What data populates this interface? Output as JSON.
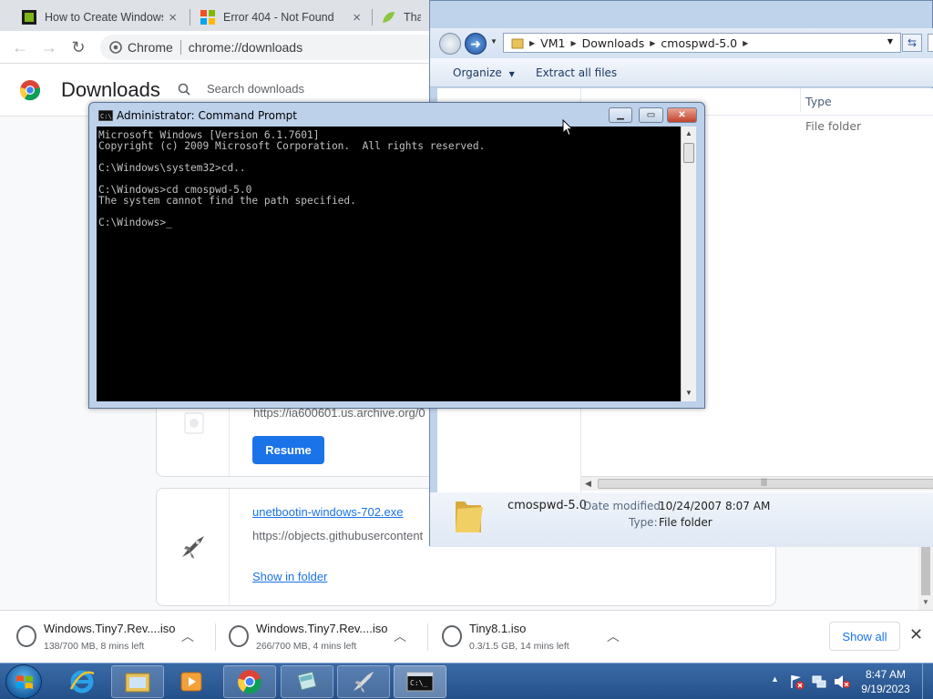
{
  "chrome": {
    "tabs": [
      {
        "title": "How to Create Windows",
        "close": "×"
      },
      {
        "title": "Error 404 - Not Found",
        "close": "×"
      },
      {
        "title": "Thank",
        "close": ""
      }
    ],
    "omnibox": {
      "chip": "Chrome",
      "url": "chrome://downloads"
    },
    "page_title": "Downloads",
    "search_placeholder": "Search downloads"
  },
  "downloads": {
    "items": [
      {
        "url": "https://ia600601.us.archive.org/0",
        "button": "Resume"
      },
      {
        "filename": "unetbootin-windows-702.exe",
        "url": "https://objects.githubusercontent",
        "action": "Show in folder"
      }
    ]
  },
  "shelf": {
    "items": [
      {
        "name": "Windows.Tiny7.Rev....iso",
        "status": "138/700 MB, 8 mins left"
      },
      {
        "name": "Windows.Tiny7.Rev....iso",
        "status": "266/700 MB, 4 mins left"
      },
      {
        "name": "Tiny8.1.iso",
        "status": "0.3/1.5 GB, 14 mins left"
      }
    ],
    "show_all": "Show all"
  },
  "explorer": {
    "breadcrumbs": [
      "VM1",
      "Downloads",
      "cmospwd-5.0"
    ],
    "commands": {
      "organize": "Organize",
      "extract": "Extract all files"
    },
    "column_header": "Type",
    "row_type": "File folder",
    "details": {
      "name": "cmospwd-5.0",
      "modified_label": "Date modified:",
      "modified_value": "10/24/2007 8:07 AM",
      "type_label": "Type:",
      "type_value": "File folder"
    }
  },
  "cmd": {
    "title": "Administrator: Command Prompt",
    "lines": [
      "Microsoft Windows [Version 6.1.7601]",
      "Copyright (c) 2009 Microsoft Corporation.  All rights reserved.",
      "",
      "C:\\Windows\\system32>cd..",
      "",
      "C:\\Windows>cd cmospwd-5.0",
      "The system cannot find the path specified.",
      "",
      "C:\\Windows>_"
    ]
  },
  "taskbar": {
    "time": "8:47 AM",
    "date": "9/19/2023"
  }
}
